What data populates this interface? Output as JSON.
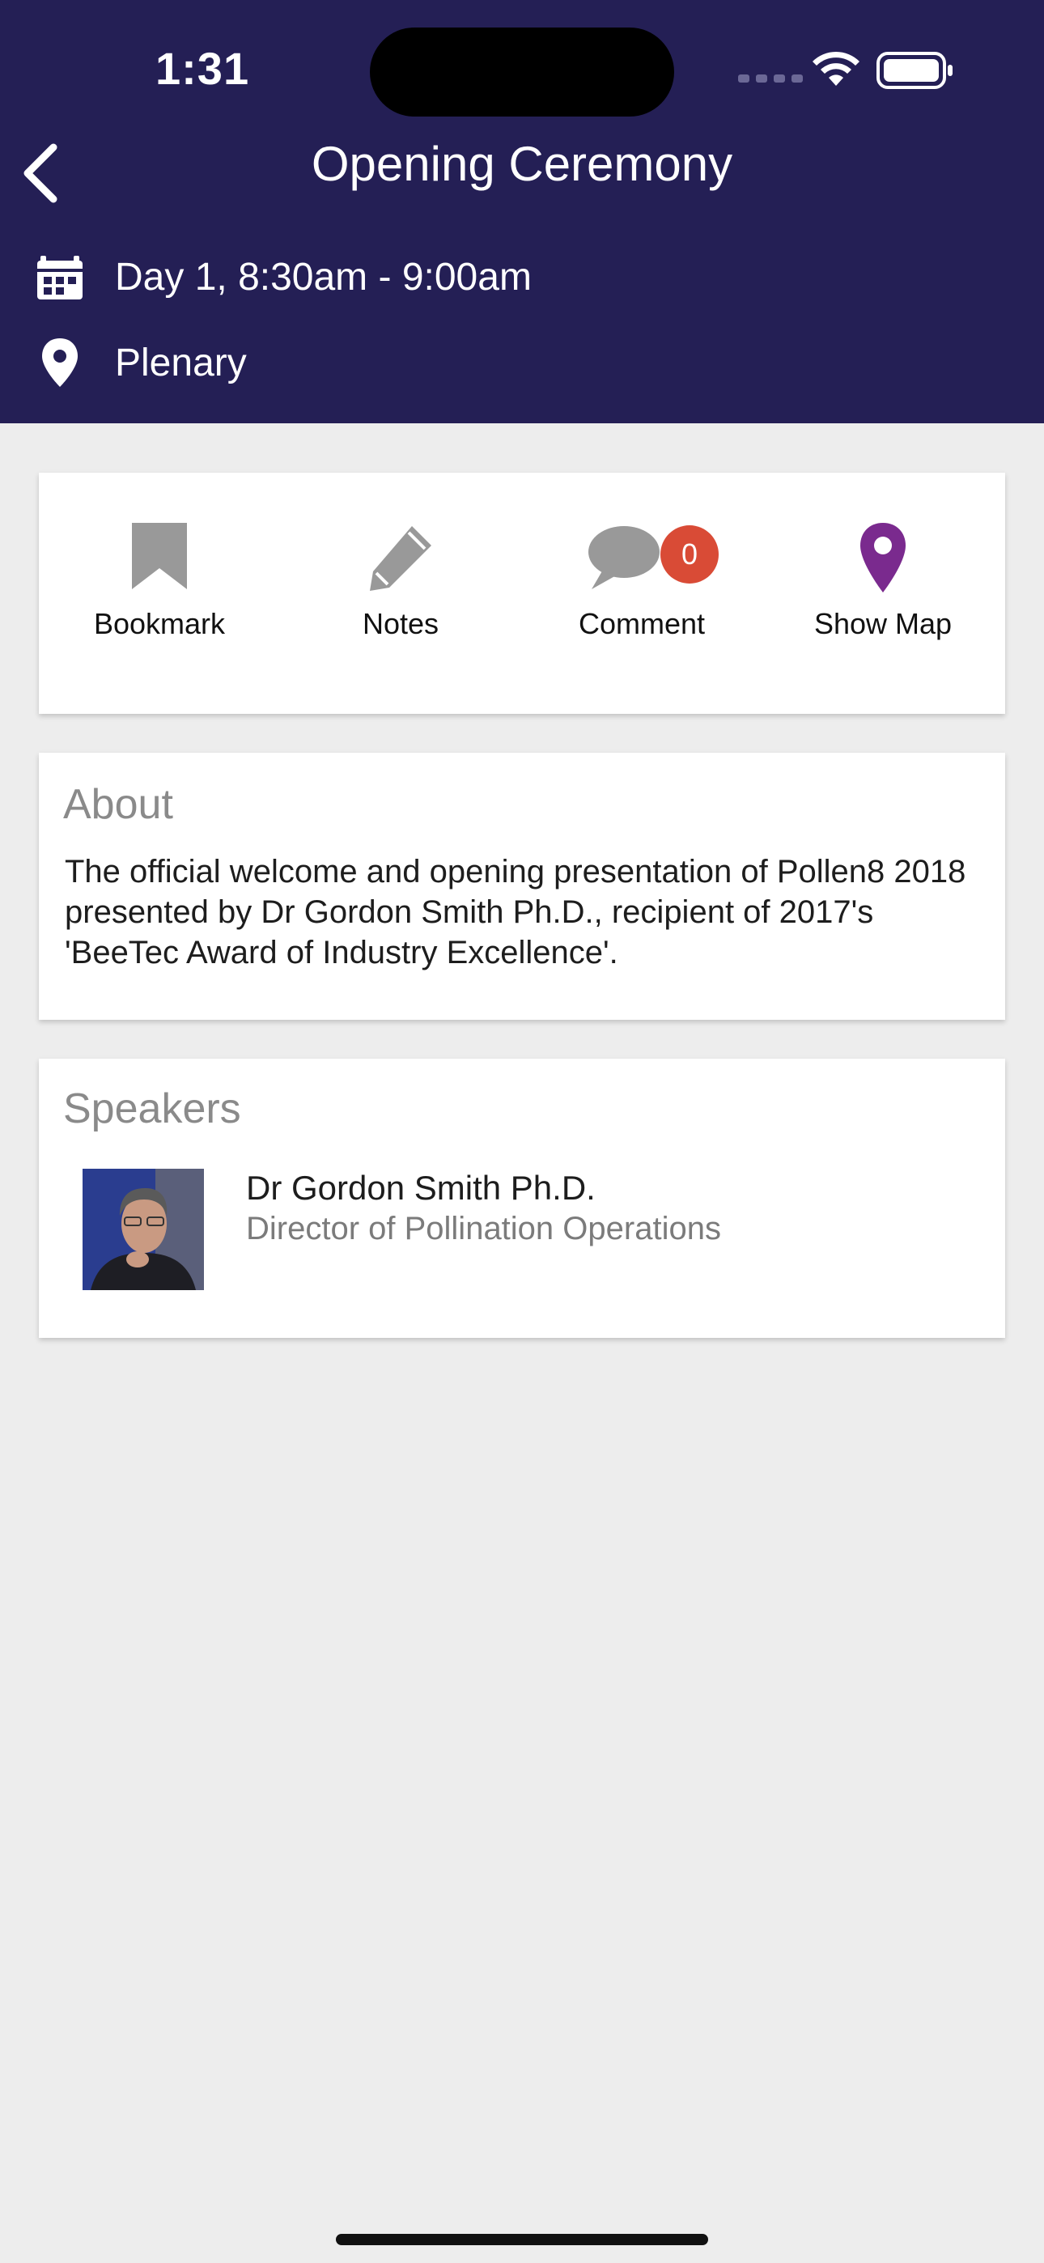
{
  "status_bar": {
    "time": "1:31"
  },
  "header": {
    "title": "Opening Ceremony",
    "schedule": "Day 1, 8:30am - 9:00am",
    "location": "Plenary",
    "background_color": "#241f55"
  },
  "actions": {
    "bookmark_label": "Bookmark",
    "notes_label": "Notes",
    "comment_label": "Comment",
    "comment_count": "0",
    "map_label": "Show Map",
    "map_icon_color": "#7a2a8e",
    "badge_color": "#d94b36"
  },
  "about": {
    "heading": "About",
    "text": "The official welcome and opening presentation of Pollen8 2018 presented by Dr Gordon Smith Ph.D., recipient of 2017's 'BeeTec Award of Industry Excellence'."
  },
  "speakers": {
    "heading": "Speakers",
    "items": [
      {
        "name": "Dr Gordon Smith Ph.D.",
        "role": "Director of Pollination Operations"
      }
    ]
  }
}
